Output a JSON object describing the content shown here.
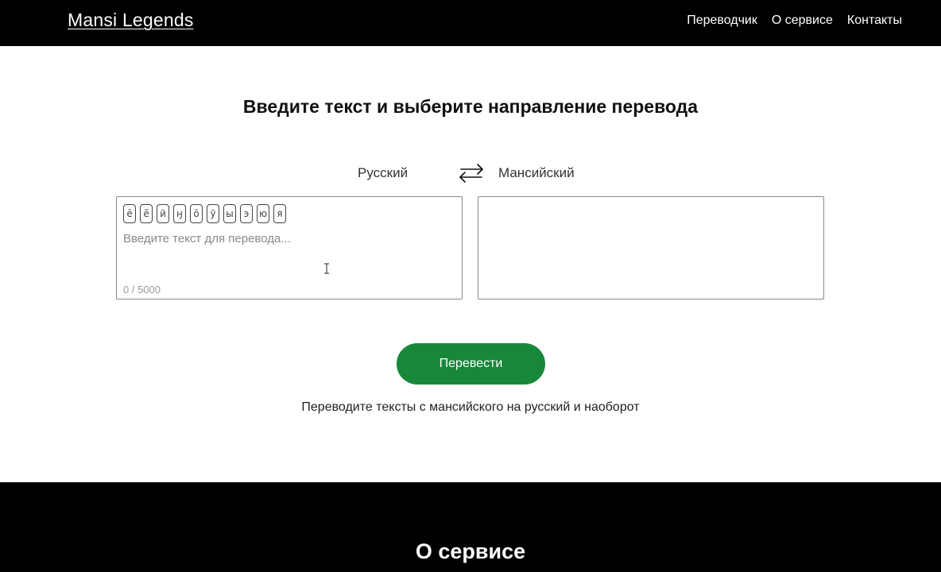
{
  "header": {
    "logo": "Mansi Legends",
    "nav": [
      {
        "label": "Переводчик"
      },
      {
        "label": "О сервисе"
      },
      {
        "label": "Контакты"
      }
    ]
  },
  "main": {
    "title": "Введите текст и выберите направление перевода",
    "source_language": "Русский",
    "target_language": "Мансийский",
    "swap_icon": "swap-arrows-icon",
    "special_chars": [
      "ē",
      "ё̄",
      "й",
      "ӈ",
      "ō",
      "ӯ",
      "ы",
      "э",
      "ю",
      "я"
    ],
    "input": {
      "placeholder": "Введите текст для перевода...",
      "value": ""
    },
    "counter": "0 / 5000",
    "output": "",
    "translate_button": "Перевести",
    "subtitle": "Переводите тексты с мансийского на русский и наоборот"
  },
  "footer": {
    "title": "О сервисе"
  },
  "colors": {
    "accent": "#17883a",
    "bar": "#000000"
  }
}
